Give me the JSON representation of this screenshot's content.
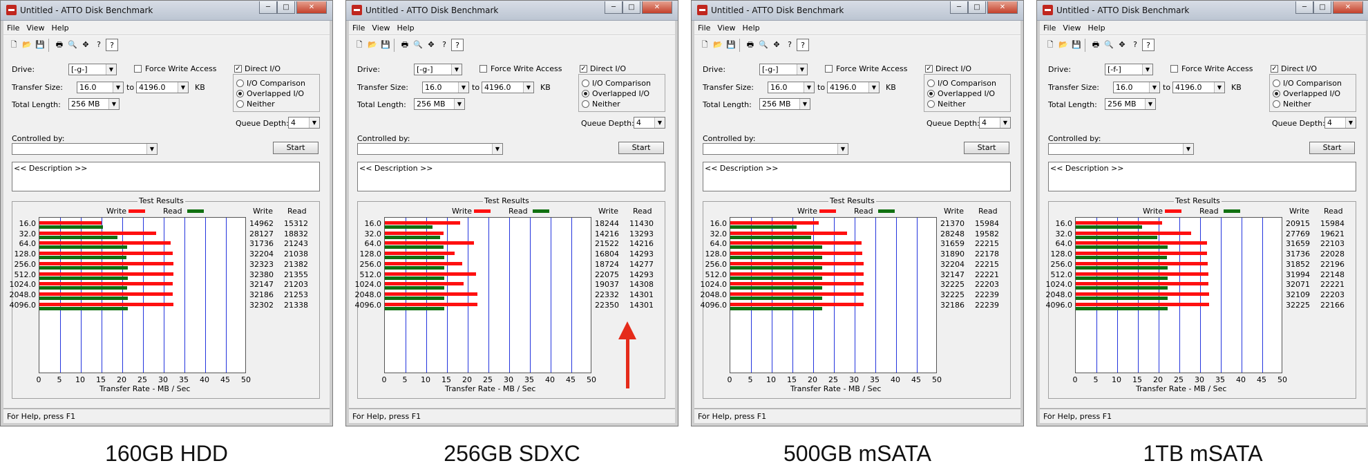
{
  "window": {
    "title": "Untitled - ATTO Disk Benchmark",
    "controls": {
      "minimize": "─",
      "maximize": "□",
      "close": "✕"
    },
    "menu": [
      "File",
      "View",
      "Help"
    ],
    "toolbar_icons": [
      "new-icon",
      "open-icon",
      "save-icon",
      "print-icon",
      "print-preview-icon",
      "move-icon",
      "help-icon",
      "context-help-icon"
    ],
    "status": "For Help, press F1"
  },
  "labels": {
    "drive": "Drive:",
    "force_write": "Force Write Access",
    "direct_io": "Direct I/O",
    "transfer_size": "Transfer Size:",
    "to": "to",
    "kb": "KB",
    "total_length": "Total Length:",
    "io_comparison": "I/O Comparison",
    "overlapped_io": "Overlapped I/O",
    "neither": "Neither",
    "queue_depth": "Queue Depth:",
    "controlled_by": "Controlled by:",
    "start": "Start",
    "description": "<< Description >>",
    "test_results": "Test Results",
    "write": "Write",
    "read": "Read",
    "x_axis_title": "Transfer Rate - MB / Sec"
  },
  "settings_common": {
    "transfer_from": "16.0",
    "transfer_to": "4196.0",
    "total_length": "256 MB",
    "queue_depth": "4",
    "direct_io_checked": true,
    "force_write_checked": false,
    "io_mode": "overlapped"
  },
  "row_labels": [
    "16.0",
    "32.0",
    "64.0",
    "128.0",
    "256.0",
    "512.0",
    "1024.0",
    "2048.0",
    "4096.0"
  ],
  "colors": {
    "write": "#ff1010",
    "read": "#107010",
    "grid": "#2233dd"
  },
  "panels": [
    {
      "caption": "160GB HDD",
      "drive": "[-g-]",
      "chart_data": {
        "type": "bar",
        "xlabel": "Transfer Rate - MB / Sec",
        "xlim": [
          0,
          50
        ],
        "x_ticks": [
          "0",
          "5",
          "10",
          "15",
          "20",
          "25",
          "30",
          "35",
          "40",
          "45",
          "50"
        ],
        "categories": [
          "16.0",
          "32.0",
          "64.0",
          "128.0",
          "256.0",
          "512.0",
          "1024.0",
          "2048.0",
          "4096.0"
        ],
        "series": [
          {
            "name": "Write",
            "values": [
              14962,
              28127,
              31736,
              32204,
              32323,
              32380,
              32147,
              32186,
              32302
            ]
          },
          {
            "name": "Read",
            "values": [
              15312,
              18832,
              21243,
              21038,
              21382,
              21355,
              21203,
              21253,
              21338
            ]
          }
        ]
      }
    },
    {
      "caption": "256GB SDXC",
      "drive": "[-g-]",
      "chart_data": {
        "type": "bar",
        "xlabel": "Transfer Rate - MB / Sec",
        "xlim": [
          0,
          50
        ],
        "x_ticks": [
          "0",
          "5",
          "10",
          "15",
          "20",
          "25",
          "30",
          "35",
          "40",
          "45",
          "50"
        ],
        "categories": [
          "16.0",
          "32.0",
          "64.0",
          "128.0",
          "256.0",
          "512.0",
          "1024.0",
          "2048.0",
          "4096.0"
        ],
        "series": [
          {
            "name": "Write",
            "values": [
              18244,
              14216,
              21522,
              16804,
              18724,
              22075,
              19037,
              22332,
              22350
            ]
          },
          {
            "name": "Read",
            "values": [
              11430,
              13293,
              14216,
              14293,
              14277,
              14293,
              14308,
              14301,
              14301
            ]
          }
        ]
      }
    },
    {
      "caption": "500GB mSATA",
      "drive": "[-g-]",
      "chart_data": {
        "type": "bar",
        "xlabel": "Transfer Rate - MB / Sec",
        "xlim": [
          0,
          50
        ],
        "x_ticks": [
          "0",
          "5",
          "10",
          "15",
          "20",
          "25",
          "30",
          "35",
          "40",
          "45",
          "50"
        ],
        "categories": [
          "16.0",
          "32.0",
          "64.0",
          "128.0",
          "256.0",
          "512.0",
          "1024.0",
          "2048.0",
          "4096.0"
        ],
        "series": [
          {
            "name": "Write",
            "values": [
              21370,
              28248,
              31659,
              31890,
              32204,
              32147,
              32225,
              32225,
              32186
            ]
          },
          {
            "name": "Read",
            "values": [
              15984,
              19582,
              22215,
              22178,
              22215,
              22221,
              22203,
              22239,
              22239
            ]
          }
        ]
      }
    },
    {
      "caption": "1TB mSATA",
      "drive": "[-f-]",
      "chart_data": {
        "type": "bar",
        "xlabel": "Transfer Rate - MB / Sec",
        "xlim": [
          0,
          50
        ],
        "x_ticks": [
          "0",
          "5",
          "10",
          "15",
          "20",
          "25",
          "30",
          "35",
          "40",
          "45",
          "50"
        ],
        "categories": [
          "16.0",
          "32.0",
          "64.0",
          "128.0",
          "256.0",
          "512.0",
          "1024.0",
          "2048.0",
          "4096.0"
        ],
        "series": [
          {
            "name": "Write",
            "values": [
              20915,
              27769,
              31659,
              31736,
              31852,
              31994,
              32071,
              32109,
              32225
            ]
          },
          {
            "name": "Read",
            "values": [
              15984,
              19621,
              22103,
              22028,
              22196,
              22148,
              22221,
              22203,
              22166
            ]
          }
        ]
      }
    }
  ]
}
